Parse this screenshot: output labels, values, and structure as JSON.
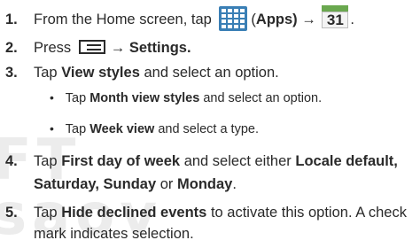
{
  "watermark": "FT\nsaov",
  "steps": [
    {
      "number": "1.",
      "part1": "From the Home screen, tap",
      "apps_icon": "apps-grid-icon",
      "paren_open": "(",
      "apps_label": "Apps",
      "paren_close": ") →",
      "calendar_icon": "calendar-icon",
      "calendar_day": "31",
      "end": "."
    },
    {
      "number": "2.",
      "part1": "Press",
      "menu_icon": "menu-icon",
      "arrow": "→",
      "settings": "Settings",
      "end": "."
    },
    {
      "number": "3.",
      "part1": "Tap",
      "bold1": "View styles",
      "part2": "and select an option.",
      "sub": [
        {
          "bullet": "•",
          "pre": "Tap",
          "bold": "Month view styles",
          "post": "and select an option."
        },
        {
          "bullet": "•",
          "pre": "Tap",
          "bold": "Week view",
          "post": "and select a type."
        }
      ]
    },
    {
      "number": "4.",
      "line1_pre": "Tap",
      "line1_bold1": "First day of week",
      "line1_mid": "and select either",
      "line1_bold2": "Locale default,",
      "line2_bold1": "Saturday, Sunday",
      "line2_mid": "or",
      "line2_bold2": "Monday",
      "line2_end": "."
    },
    {
      "number": "5.",
      "line1_pre": "Tap",
      "line1_bold": "Hide declined events",
      "line1_post": "to activate this option. A check",
      "line2": "mark indicates selection."
    }
  ]
}
